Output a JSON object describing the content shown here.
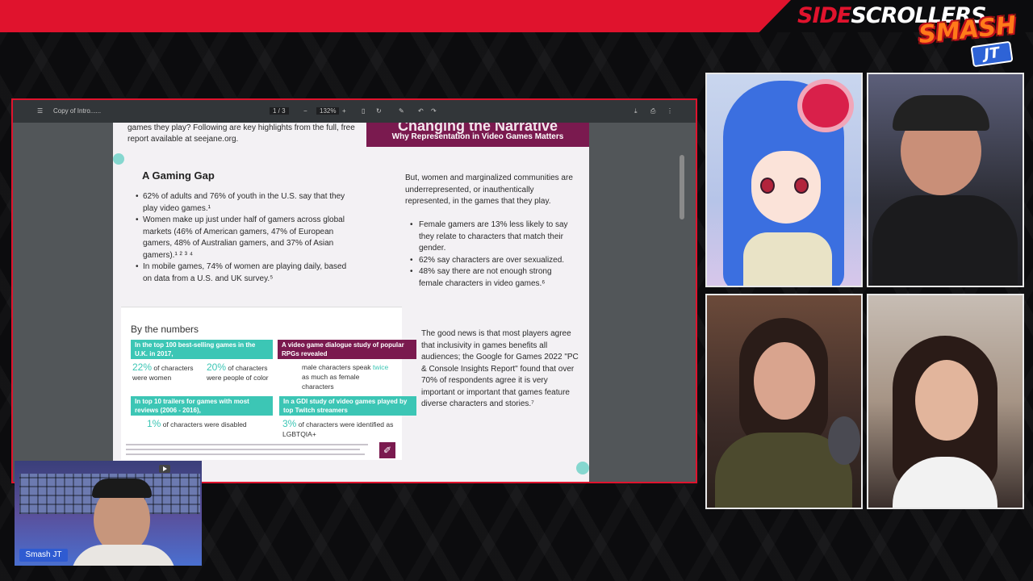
{
  "brand": {
    "side": "SIDE",
    "scrollers": "SCROLLERS",
    "smash": "SMASH",
    "jt": "JT"
  },
  "pdf": {
    "doc_title": "Copy of Intro......",
    "page_indicator": "1 / 3",
    "zoom": "132%",
    "intro_text": "games they play? Following are key highlights from the full, free report available at seejane.org.",
    "banner_title": "Changing the Narrative",
    "banner_subtitle": "Why Representation in Video Games Matters",
    "gap_title": "A Gaming Gap",
    "gap_items": [
      "62% of adults and 76% of youth in the U.S. say that they play video games.¹",
      "Women make up just under half of gamers across global markets (46% of American gamers, 47% of European gamers, 48% of Australian gamers, and 37% of Asian gamers).¹ ² ³ ⁴",
      "In mobile games, 74% of women are playing daily, based on data from a U.S. and UK survey.⁵"
    ],
    "under_text": "But, women and marginalized communities are underrepresented, or inauthentically represented, in the games that they play.",
    "under_items": [
      "Female gamers are 13% less likely to say they relate to characters that match their gender.",
      "62% say characters are over sexualized.",
      "48% say there are not enough strong female characters in video games.⁶"
    ],
    "numbers_title": "By the numbers",
    "stat1_head": "In the top 100 best-selling games in the U.K. in 2017,",
    "stat1_a_pct": "22%",
    "stat1_a_text": "of characters were women",
    "stat1_b_pct": "20%",
    "stat1_b_text": "of characters were people of color",
    "stat2_head": "A video game dialogue study of popular RPGs revealed",
    "stat2_text_a": "male characters speak",
    "stat2_text_tw": "twice",
    "stat2_text_b": "as much as female characters",
    "stat3_head": "In top 10 trailers for games with most reviews (2006 - 2016),",
    "stat3_pct": "1%",
    "stat3_text": "of characters were disabled",
    "stat4_head": "In a GDI study of video games played by top Twitch streamers",
    "stat4_pct": "3%",
    "stat4_text": "of characters were identified as LGBTQIA+",
    "good_news": "The good news is that most players agree that inclusivity in games benefits all audiences; the Google for Games 2022 \"PC & Console Insights Report\" found that over 70% of respondents agree it is very important or important that games feature diverse characters and stories.⁷"
  },
  "host": {
    "name": "Smash JT"
  },
  "colors": {
    "accent": "#e0132d",
    "plum": "#7a1a4f",
    "teal": "#3cc6b5"
  }
}
